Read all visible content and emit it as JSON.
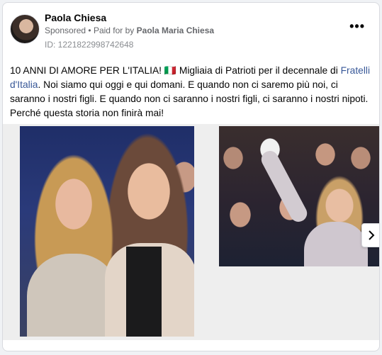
{
  "post": {
    "author": "Paola Chiesa",
    "sponsored": "Sponsored",
    "separator": "•",
    "paid_for_prefix": "Paid for by",
    "paid_for_name": "Paola Maria Chiesa",
    "ad_id": "ID: 1221822998742648",
    "menu_label": "•••",
    "text_before_link": "10 ANNI DI AMORE PER L'ITALIA! 🇮🇹 Migliaia di Patrioti per il decennale di ",
    "link_text": "Fratelli d'Italia",
    "text_after_link": ". Noi siamo qui oggi e qui domani. E quando non ci saremo più noi, ci saranno i nostri figli. E quando non ci saranno i nostri figli, ci saranno i nostri nipoti. Perché questa storia non finirà mai!"
  },
  "carousel": {
    "next_icon": "chevron-right-icon"
  },
  "colors": {
    "link": "#385898",
    "secondary_text": "#65676b"
  }
}
